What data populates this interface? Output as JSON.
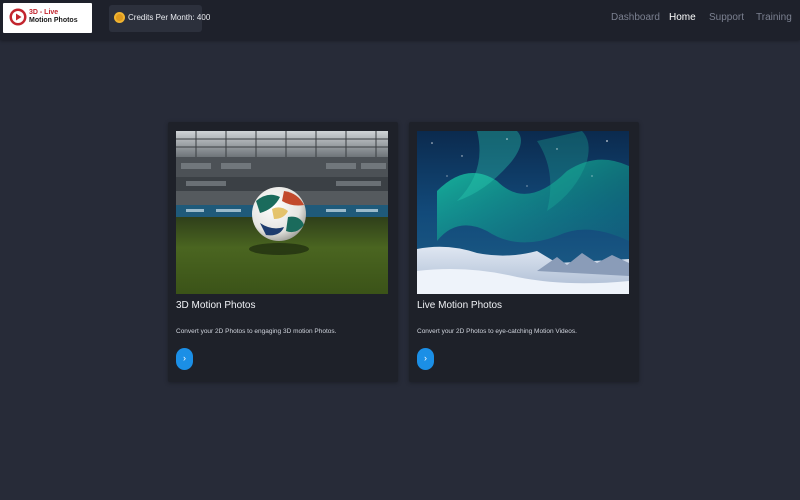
{
  "logo": {
    "line1": "3D - Live",
    "line2": "Motion Photos"
  },
  "credits": {
    "label": "Credits Per Month: 400",
    "icon": "coin-icon"
  },
  "nav": {
    "items": [
      {
        "label": "Dashboard",
        "active": false
      },
      {
        "label": "Home",
        "active": true
      },
      {
        "label": "Support",
        "active": false
      },
      {
        "label": "Training",
        "active": false
      }
    ]
  },
  "cards": [
    {
      "title": "3D Motion Photos",
      "description": "Convert your 2D Photos to engaging 3D motion Photos.",
      "button_icon": "chevron-right-icon",
      "image": "soccer-ball-stadium"
    },
    {
      "title": "Live Motion Photos",
      "description": "Convert your 2D Photos to eye-catching Motion Videos.",
      "button_icon": "chevron-right-icon",
      "image": "aurora-snow-landscape"
    }
  ],
  "colors": {
    "background": "#272b38",
    "topbar": "#1e212b",
    "card": "#1e2129",
    "accent": "#1b8fe6",
    "logo_red": "#c2252e",
    "coin": "#f0b431"
  }
}
